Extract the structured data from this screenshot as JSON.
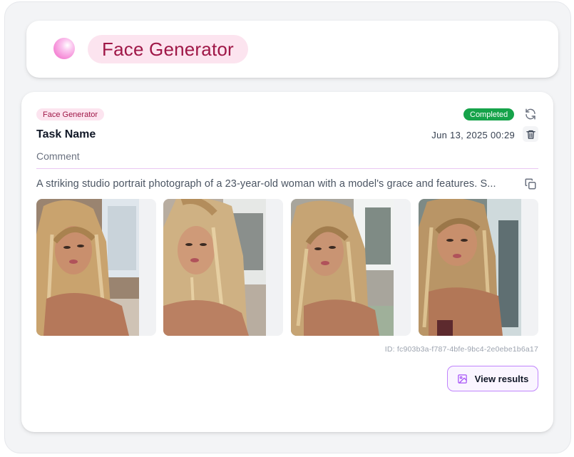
{
  "header": {
    "title": "Face Generator"
  },
  "task": {
    "type_badge": "Face Generator",
    "status": "Completed",
    "name": "Task Name",
    "date": "Jun 13, 2025 00:29",
    "comment": "Comment",
    "prompt": "A striking studio portrait photograph of a 23-year-old woman with a model's grace and features. S...",
    "id_text": "ID: fc903b3a-f787-4bfe-9bc4-2e0ebe1b6a17",
    "view_results_label": "View results",
    "colors": {
      "accent": "#9f1747",
      "status": "#16a34a",
      "button_border": "#c084fc"
    },
    "icons": [
      "refresh-icon",
      "trash-icon",
      "copy-icon",
      "image-icon"
    ]
  }
}
